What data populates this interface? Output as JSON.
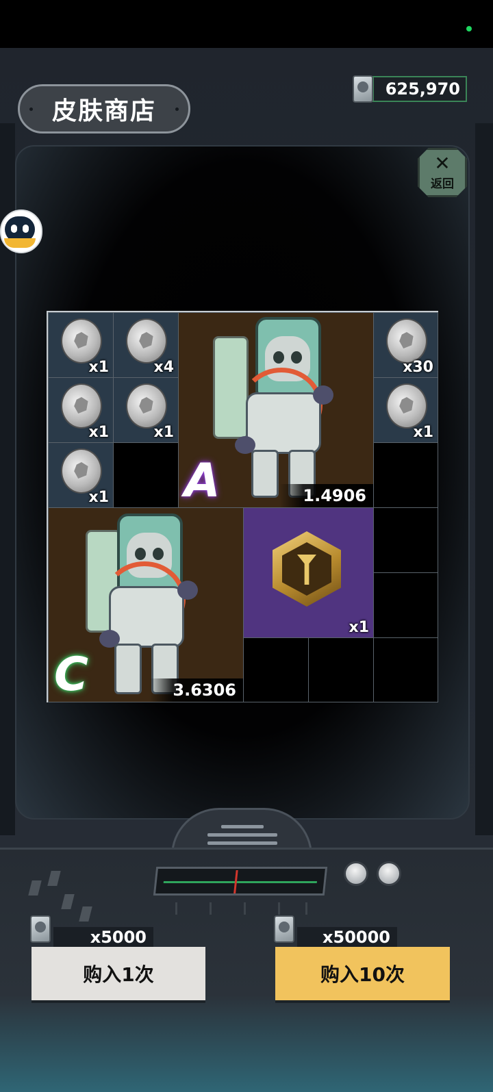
{
  "header": {
    "title": "皮肤商店",
    "currency_amount": "625,970",
    "currency_icon": "skin-card-icon",
    "back_label": "返回",
    "back_icon": "close-x-icon"
  },
  "grid": {
    "coin_cells": [
      {
        "qty": "x1"
      },
      {
        "qty": "x4"
      },
      {
        "qty": "x30"
      },
      {
        "qty": "x1"
      },
      {
        "qty": "x1"
      },
      {
        "qty": "x1"
      },
      {
        "qty": "x1"
      }
    ],
    "skin_a": {
      "rank": "A",
      "value": "1.4906"
    },
    "skin_c": {
      "rank": "C",
      "value": "3.6306"
    },
    "badge": {
      "qty": "x1",
      "icon": "hexagon-badge-icon"
    }
  },
  "purchase": {
    "single": {
      "cost": "x5000",
      "label": "购入1次"
    },
    "ten": {
      "cost": "x50000",
      "label": "购入10次"
    }
  },
  "colors": {
    "accent_gold": "#f1c35d",
    "button_gray": "#e3e1de",
    "cell_purple": "#503480",
    "cell_brown": "#3b2814",
    "cell_coin": "#2a3a49"
  }
}
